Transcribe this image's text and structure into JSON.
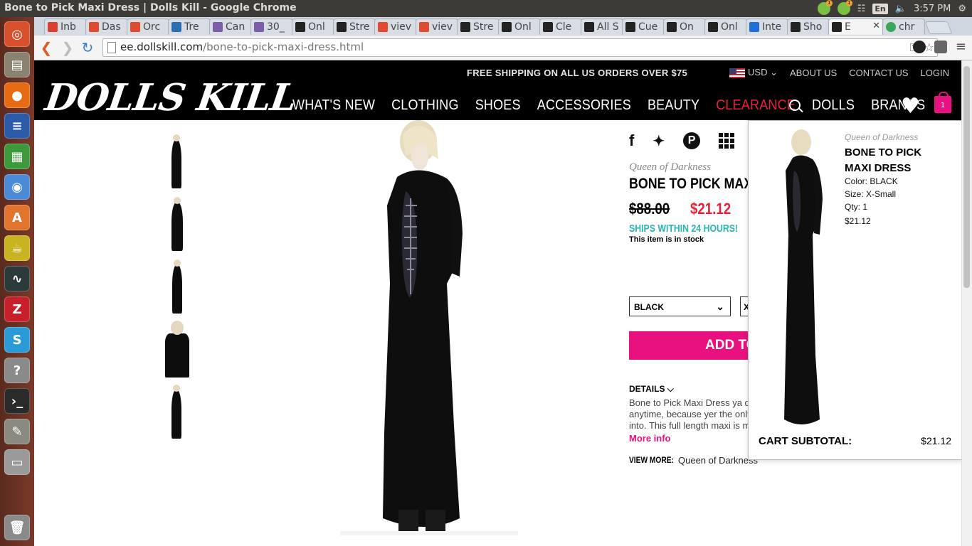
{
  "os": {
    "window_title": "Bone to Pick Maxi Dress | Dolls Kill - Google Chrome",
    "lang": "En",
    "clock": "3:57 PM"
  },
  "tabs": [
    {
      "label": "Inb",
      "color": "#d9412f"
    },
    {
      "label": "Das",
      "color": "#e04a2f"
    },
    {
      "label": "Orc",
      "color": "#e04a2f"
    },
    {
      "label": "Tre",
      "color": "#2a6fb5"
    },
    {
      "label": "Can",
      "color": "#7b5ea7"
    },
    {
      "label": "30_",
      "color": "#7b5ea7"
    },
    {
      "label": "Onl",
      "color": "#222222"
    },
    {
      "label": "Stre",
      "color": "#222222"
    },
    {
      "label": "viev",
      "color": "#e04a2f"
    },
    {
      "label": "viev",
      "color": "#e04a2f"
    },
    {
      "label": "Stre",
      "color": "#222222"
    },
    {
      "label": "Onl",
      "color": "#222222"
    },
    {
      "label": "Cle",
      "color": "#222222"
    },
    {
      "label": "All S",
      "color": "#222222"
    },
    {
      "label": "Cue",
      "color": "#222222"
    },
    {
      "label": "On",
      "color": "#222222"
    },
    {
      "label": "Onl",
      "color": "#222222"
    },
    {
      "label": "Inte",
      "color": "#1e6fd9"
    },
    {
      "label": "Sho",
      "color": "#222222"
    },
    {
      "label": "E",
      "color": "#222222"
    },
    {
      "label": "chr",
      "color": "#3aa55b"
    }
  ],
  "omnibox": {
    "domain": "ee.dollskill.com",
    "path": "/bone-to-pick-maxi-dress.html"
  },
  "site": {
    "promo": "FREE SHIPPING ON ALL US ORDERS OVER $75",
    "currency": "USD",
    "about": "ABOUT US",
    "contact": "CONTACT US",
    "login": "LOGIN",
    "logo": "DOLLS KILL",
    "nav": [
      "WHAT'S NEW",
      "CLOTHING",
      "SHOES",
      "ACCESSORIES",
      "BEAUTY",
      "CLEARANCE",
      "DOLLS",
      "BRANDS"
    ],
    "cart_count": "1"
  },
  "product": {
    "brand": "Queen of Darkness",
    "title": "BONE TO PICK MAXI DR",
    "old_price": "$88.00",
    "new_price": "$21.12",
    "ships": "SHIPS WITHIN 24 HOURS!",
    "stock": "This item is in stock",
    "color_option": "BLACK",
    "size_option": "X",
    "add_to_cart": "ADD TO CA",
    "details_label": "DETAILS",
    "desc_lines": [
      "Bone to Pick Maxi Dress ya d",
      "anytime, because yer the only",
      "into. This full length maxi is m"
    ],
    "more_info": "More info",
    "view_more_label": "VIEW MORE:",
    "view_more_value": "Queen of Darkness"
  },
  "social": {
    "facebook": "f",
    "twitter": "🐦",
    "pinterest": "P"
  },
  "minicart": {
    "brand": "Queen of Darkness",
    "title": "BONE TO PICK MAXI DRESS",
    "color": "Color: BLACK",
    "size": "Size:   X-Small",
    "qty": "Qty: 1",
    "price": "$21.12",
    "subtotal_label": "CART  SUBTOTAL:",
    "subtotal_value": "$21.12"
  }
}
